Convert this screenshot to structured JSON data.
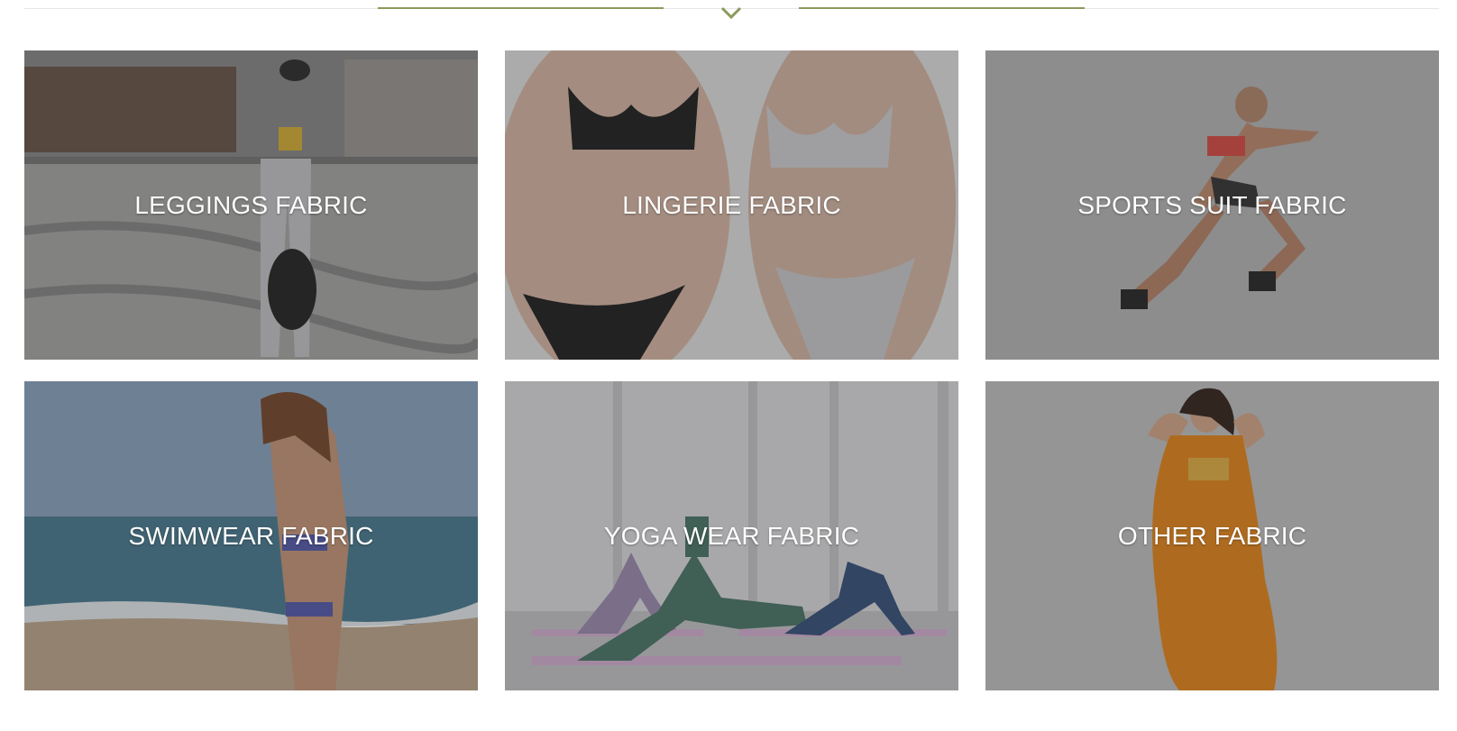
{
  "header": {
    "divider_icon": "chevron-down-icon",
    "accent_color": "#8a9a5b"
  },
  "categories": [
    {
      "label": "LEGGINGS FABRIC"
    },
    {
      "label": "LINGERIE FABRIC"
    },
    {
      "label": "SPORTS SUIT FABRIC"
    },
    {
      "label": "SWIMWEAR FABRIC"
    },
    {
      "label": "YOGA WEAR FABRIC"
    },
    {
      "label": "OTHER FABRIC"
    }
  ]
}
